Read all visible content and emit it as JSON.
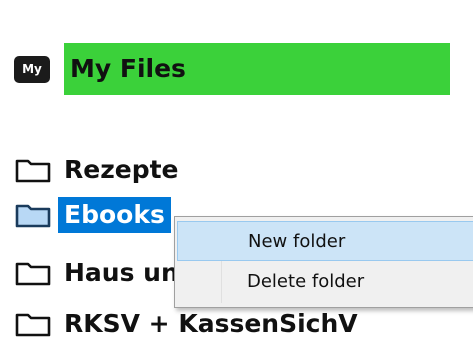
{
  "tree": {
    "root": {
      "badge": "My",
      "label": "My Files",
      "color": "#3bd13a"
    },
    "folders": [
      {
        "label": "Rezepte",
        "selected": false
      },
      {
        "label": "Ebooks",
        "selected": true
      },
      {
        "label": "Haus und Garten",
        "selected": false
      },
      {
        "label": "RKSV + KassenSichV",
        "selected": false
      }
    ],
    "selection_color": "#0078d7"
  },
  "context_menu": {
    "items": [
      {
        "label": "New folder",
        "hovered": true
      },
      {
        "label": "Delete folder",
        "hovered": false
      }
    ],
    "hover_color": "#cce4f7"
  },
  "icons": {
    "root": "my-files-badge-icon",
    "folder": "folder-icon"
  }
}
